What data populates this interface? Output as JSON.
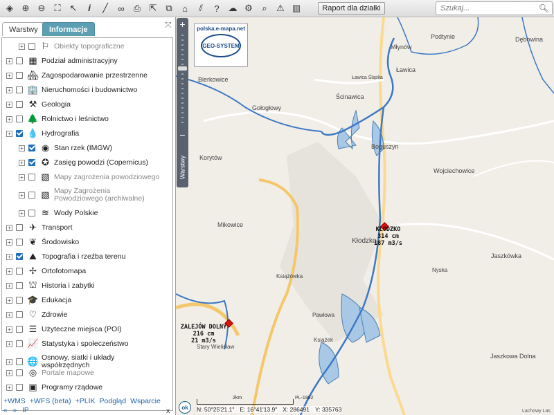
{
  "toolbar": {
    "report_label": "Raport dla działki",
    "search_placeholder": "Szukaj...",
    "icons": [
      "layers-icon",
      "zoom-in-icon",
      "zoom-out-icon",
      "full-extent-icon",
      "pointer-icon",
      "info-icon",
      "measure-line-icon",
      "link-icon",
      "print-icon",
      "export-icon",
      "copy-icon",
      "bookmark-icon",
      "draw-icon",
      "help-icon",
      "cloud-upload-icon",
      "settings-icon",
      "search-plus-icon",
      "warning-icon",
      "pattern-icon"
    ]
  },
  "panel": {
    "tabs": [
      "Warstwy",
      "Informacje"
    ],
    "layers": [
      {
        "label": "Obiekty topograficzne",
        "checked": false,
        "indent": 1,
        "grey": true,
        "icon": "topo-objects-icon",
        "glyph": "⚐"
      },
      {
        "label": "Podział administracyjny",
        "checked": false,
        "indent": 0,
        "grey": false,
        "icon": "admin-division-icon",
        "glyph": "▦"
      },
      {
        "label": "Zagospodarowanie przestrzenne",
        "checked": false,
        "indent": 0,
        "grey": false,
        "icon": "spatial-planning-icon",
        "glyph": "🏘"
      },
      {
        "label": "Nieruchomości i budownictwo",
        "checked": false,
        "indent": 0,
        "grey": false,
        "icon": "buildings-icon",
        "glyph": "🏢"
      },
      {
        "label": "Geologia",
        "checked": false,
        "indent": 0,
        "grey": false,
        "icon": "pickaxe-icon",
        "glyph": "⚒"
      },
      {
        "label": "Rolnictwo i leśnictwo",
        "checked": false,
        "indent": 0,
        "grey": false,
        "icon": "agriculture-icon",
        "glyph": "🌲"
      },
      {
        "label": "Hydrografia",
        "checked": true,
        "indent": 0,
        "grey": false,
        "icon": "water-drop-icon",
        "glyph": "💧"
      },
      {
        "label": "Stan rzek (IMGW)",
        "checked": true,
        "indent": 1,
        "grey": false,
        "icon": "river-gauge-icon",
        "glyph": "◉"
      },
      {
        "label": "Zasięg powodzi (Copernicus)",
        "checked": true,
        "indent": 1,
        "grey": false,
        "icon": "eu-flag-icon",
        "glyph": "✪"
      },
      {
        "label": "Mapy zagrożenia powodziowego",
        "checked": false,
        "indent": 1,
        "grey": true,
        "icon": "flood-hazard-map-icon",
        "glyph": "▧"
      },
      {
        "label": "Mapy Zagrożenia Powodziowego (archiwalne)",
        "checked": false,
        "indent": 1,
        "grey": true,
        "icon": "flood-archive-map-icon",
        "glyph": "▧"
      },
      {
        "label": "Wody Polskie",
        "checked": false,
        "indent": 1,
        "grey": false,
        "icon": "waves-icon",
        "glyph": "≋"
      },
      {
        "label": "Transport",
        "checked": false,
        "indent": 0,
        "grey": false,
        "icon": "transport-icon",
        "glyph": "✈"
      },
      {
        "label": "Środowisko",
        "checked": false,
        "indent": 0,
        "grey": false,
        "icon": "leaf-icon",
        "glyph": "❦"
      },
      {
        "label": "Topografia i rzeźba terenu",
        "checked": true,
        "indent": 0,
        "grey": false,
        "icon": "topography-icon",
        "glyph": "⛰"
      },
      {
        "label": "Ortofotomapa",
        "checked": false,
        "indent": 0,
        "grey": false,
        "icon": "satellite-icon",
        "glyph": "✢"
      },
      {
        "label": "Historia i zabytki",
        "checked": false,
        "indent": 0,
        "grey": false,
        "icon": "history-icon",
        "glyph": "⛫"
      },
      {
        "label": "Edukacja",
        "checked": false,
        "indent": 0,
        "grey": false,
        "icon": "graduation-cap-icon",
        "glyph": "🎓"
      },
      {
        "label": "Zdrowie",
        "checked": false,
        "indent": 0,
        "grey": false,
        "icon": "heart-icon",
        "glyph": "♡"
      },
      {
        "label": "Użyteczne miejsca (POI)",
        "checked": false,
        "indent": 0,
        "grey": false,
        "icon": "stack-icon",
        "glyph": "☰"
      },
      {
        "label": "Statystyka i społeczeństwo",
        "checked": false,
        "indent": 0,
        "grey": false,
        "icon": "statistics-chart-icon",
        "glyph": "📈"
      },
      {
        "label": "Osnowy, siatki i układy współrzędnych",
        "checked": false,
        "indent": 0,
        "grey": false,
        "icon": "globe-grid-icon",
        "glyph": "🌐"
      },
      {
        "label": "Portale mapowe",
        "checked": false,
        "indent": 0,
        "grey": true,
        "icon": "map-portals-icon",
        "glyph": "◎"
      },
      {
        "label": "Programy rządowe",
        "checked": false,
        "indent": 0,
        "grey": false,
        "icon": "government-programs-icon",
        "glyph": "▣"
      }
    ],
    "footer_links": [
      "+WMS",
      "+WFS (beta)",
      "+PLIK",
      "Podgląd",
      "Wsparcie"
    ],
    "footer_row2": [
      "«",
      "»",
      "IP"
    ],
    "footer_close": "x"
  },
  "map": {
    "logo_url": "polska.e-mapa.net",
    "logo_name": "GEO-SYSTEM",
    "layers_tab": "Warstwy",
    "places": [
      {
        "name": "Młynów"
      },
      {
        "name": "Podtynie"
      },
      {
        "name": "Dębowina"
      },
      {
        "name": "Ławica"
      },
      {
        "name": "Bierkowice"
      },
      {
        "name": "Ławica Śląska"
      },
      {
        "name": "Ścinawica"
      },
      {
        "name": "Gołogłowy"
      },
      {
        "name": "Boguszyn"
      },
      {
        "name": "Korytów"
      },
      {
        "name": "Wojciechowice"
      },
      {
        "name": "Mikowice"
      },
      {
        "name": "Kłodzko"
      },
      {
        "name": "Jaszkówka"
      },
      {
        "name": "Nyska"
      },
      {
        "name": "Książówka"
      },
      {
        "name": "Pawłowa"
      },
      {
        "name": "Książek"
      },
      {
        "name": "Jaszkowa Dolna"
      },
      {
        "name": "Stary Wielisław"
      }
    ],
    "gauges": [
      {
        "name": "KŁODZKO",
        "level": "314 cm",
        "flow": "187 m3/s"
      },
      {
        "name": "ZALEJÓW DOLNY",
        "level": "216 cm",
        "flow": "21 m3/s"
      }
    ],
    "ok_label": "ok",
    "scale_label": "2km",
    "projection": "PL-1992",
    "coords": {
      "n": "N: 50°25'21.1\"",
      "e": "E: 16°41'13.9\"",
      "x": "X: 286491",
      "y": "Y: 335763"
    },
    "copyright": "Lachowy Las"
  }
}
